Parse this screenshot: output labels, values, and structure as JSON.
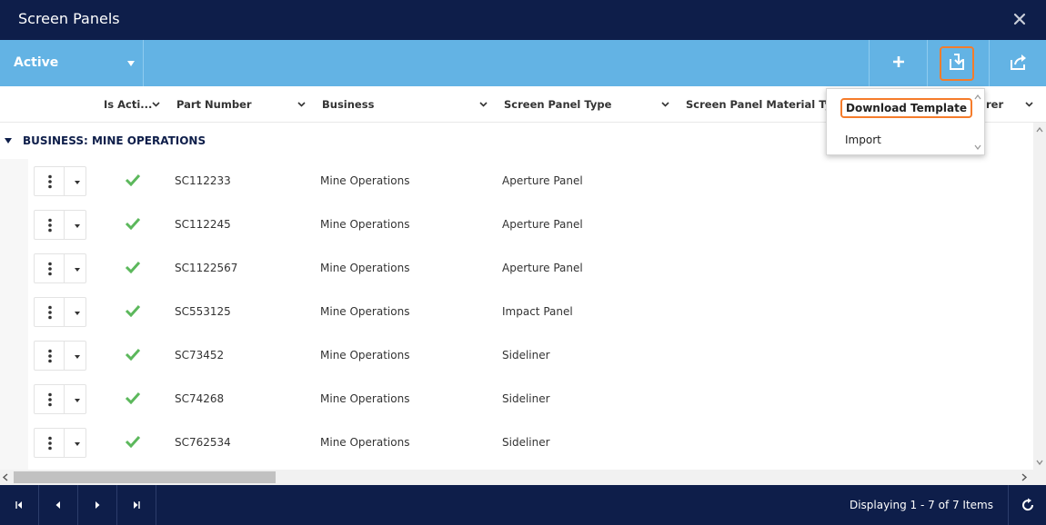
{
  "window": {
    "title": "Screen Panels",
    "close_icon": "close-icon"
  },
  "toolbar": {
    "filter_value": "Active",
    "buttons": [
      {
        "icon": "plus-icon"
      },
      {
        "icon": "import-export-icon",
        "highlighted": true
      },
      {
        "icon": "share-icon"
      }
    ]
  },
  "columns": [
    {
      "label": "Is Acti..."
    },
    {
      "label": "Part Number"
    },
    {
      "label": "Business"
    },
    {
      "label": "Screen Panel Type"
    },
    {
      "label": "Screen Panel Material Type"
    },
    {
      "label": "rer"
    }
  ],
  "group": {
    "label": "BUSINESS: MINE OPERATIONS"
  },
  "rows": [
    {
      "part_number": "SC112233",
      "business": "Mine Operations",
      "type": "Aperture Panel",
      "active": true
    },
    {
      "part_number": "SC112245",
      "business": "Mine Operations",
      "type": "Aperture Panel",
      "active": true
    },
    {
      "part_number": "SC1122567",
      "business": "Mine Operations",
      "type": "Aperture Panel",
      "active": true
    },
    {
      "part_number": "SC553125",
      "business": "Mine Operations",
      "type": "Impact Panel",
      "active": true
    },
    {
      "part_number": "SC73452",
      "business": "Mine Operations",
      "type": "Sideliner",
      "active": true
    },
    {
      "part_number": "SC74268",
      "business": "Mine Operations",
      "type": "Sideliner",
      "active": true
    },
    {
      "part_number": "SC762534",
      "business": "Mine Operations",
      "type": "Sideliner",
      "active": true
    }
  ],
  "dropdown": {
    "items": [
      {
        "label": "Download Template",
        "highlighted": true
      },
      {
        "label": "Import"
      }
    ]
  },
  "footer": {
    "status": "Displaying 1 - 7 of 7 Items"
  },
  "colors": {
    "title_bar": "#0e1e4a",
    "toolbar": "#63b3e4",
    "highlight": "#f57c2b",
    "check": "#5cb85c"
  }
}
